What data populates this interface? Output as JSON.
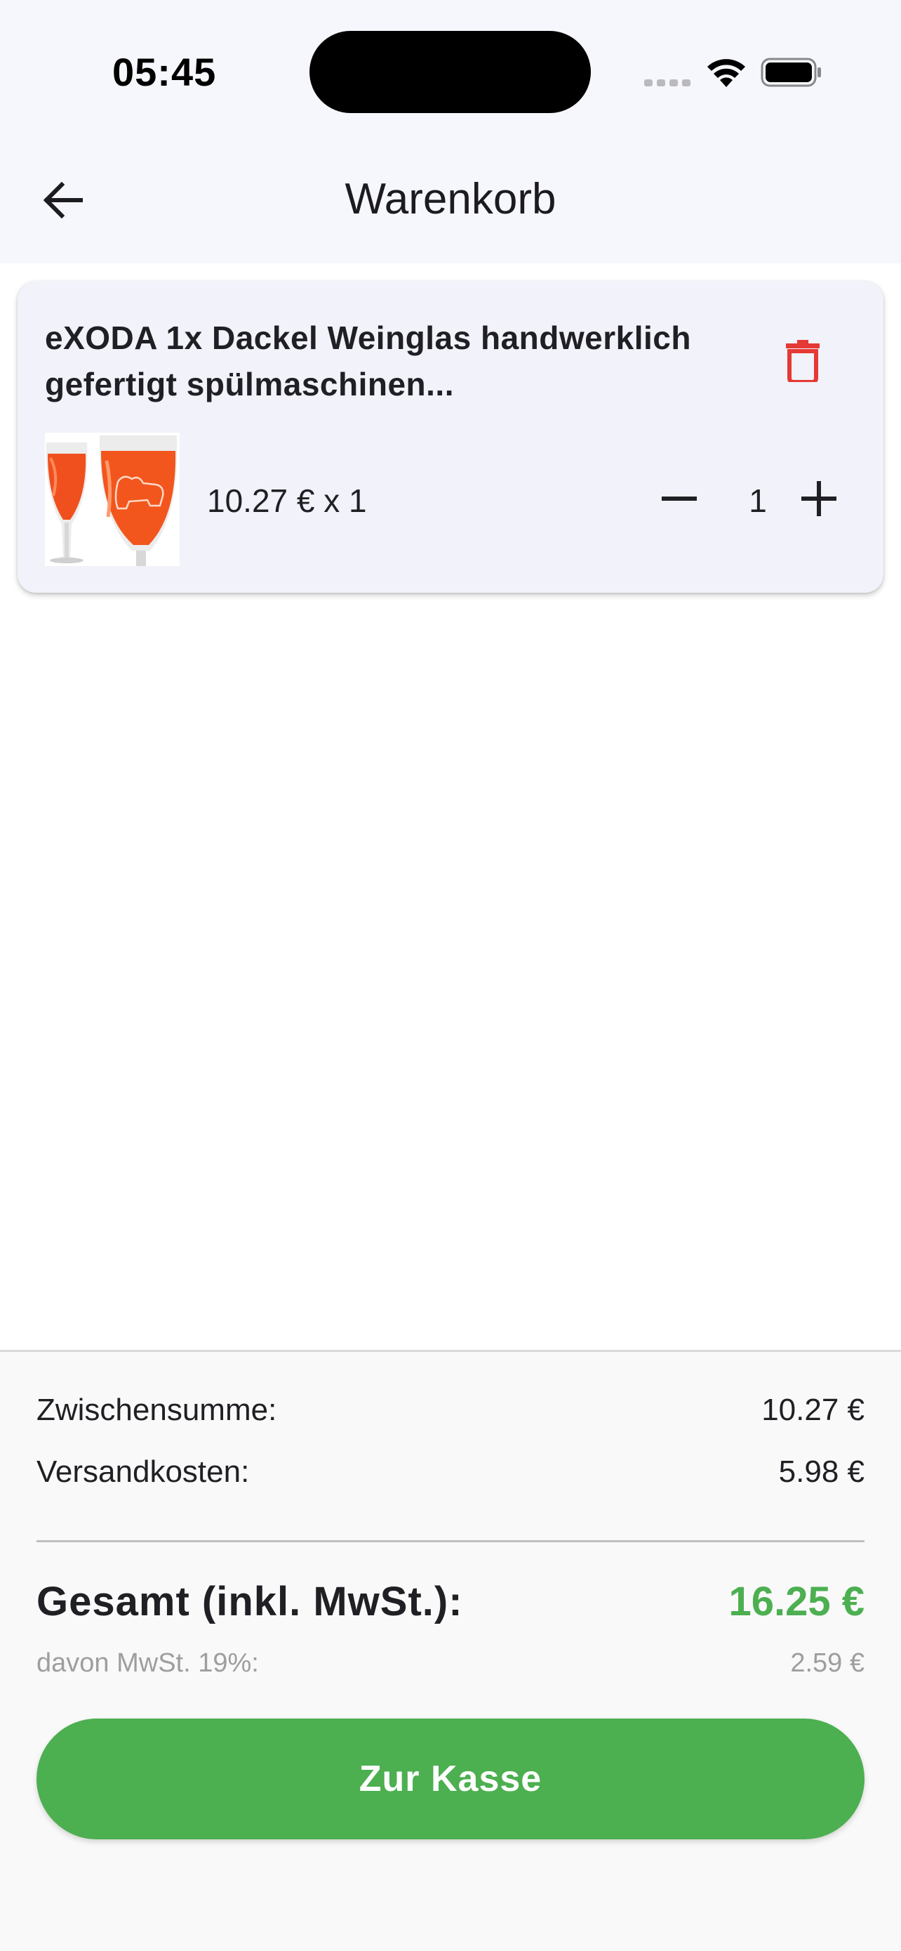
{
  "status_bar": {
    "time": "05:45",
    "icons": [
      "signal-icon",
      "wifi-icon",
      "battery-icon"
    ]
  },
  "app_bar": {
    "back_icon": "arrow-left-icon",
    "title": "Warenkorb"
  },
  "cart": {
    "items": [
      {
        "title": "eXODA 1x Dackel Weinglas handwerklich gefertigt spülmaschinen...",
        "price_line": "10.27 € x 1",
        "quantity": "1",
        "delete_icon": "trash-icon",
        "minus_icon": "minus-icon",
        "plus_icon": "plus-icon",
        "image": "product-thumbnail"
      }
    ]
  },
  "summary": {
    "subtotal_label": "Zwischensumme:",
    "subtotal_value": "10.27 €",
    "shipping_label": "Versandkosten:",
    "shipping_value": "5.98 €",
    "total_label": "Gesamt (inkl. MwSt.):",
    "total_value": "16.25 €",
    "vat_label": "davon MwSt. 19%:",
    "vat_value": "2.59 €",
    "checkout_label": "Zur Kasse"
  },
  "colors": {
    "accent": "#4caf50",
    "delete": "#e53935",
    "card_background": "#f1f2fa",
    "header_background": "#f6f7fc"
  }
}
